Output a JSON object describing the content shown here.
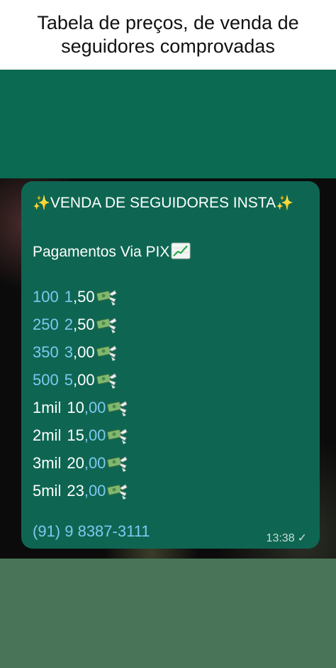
{
  "caption": "Tabela de preços, de venda de seguidores comprovadas",
  "message": {
    "title_sparkle": "✨",
    "title": "VENDA DE SEGUIDORES INSTA",
    "payments_label": "Pagamentos Via PIX",
    "payments_icon": "chart-increasing-icon",
    "price_icon": "money-with-wings-icon",
    "prices": [
      {
        "qty": "100",
        "int": "1",
        "dec": ",50"
      },
      {
        "qty": "250",
        "int": "2",
        "dec": ",50"
      },
      {
        "qty": "350",
        "int": "3",
        "dec": ",00"
      },
      {
        "qty": "500",
        "int": "5",
        "dec": ",00"
      },
      {
        "qty": "1mil",
        "int": "10",
        "dec": ",00"
      },
      {
        "qty": "2mil",
        "int": "15",
        "dec": ",00"
      },
      {
        "qty": "3mil",
        "int": "20",
        "dec": ",00"
      },
      {
        "qty": "5mil",
        "int": "23",
        "dec": ",00"
      }
    ],
    "phone": "(91) 9 8387-3111",
    "time": "13:38",
    "status_icon": "check-icon"
  },
  "colors": {
    "bubble": "#0e6652",
    "link": "#7fc8f0",
    "band_top": "#0b6a52",
    "band_bottom": "#4a7458"
  }
}
